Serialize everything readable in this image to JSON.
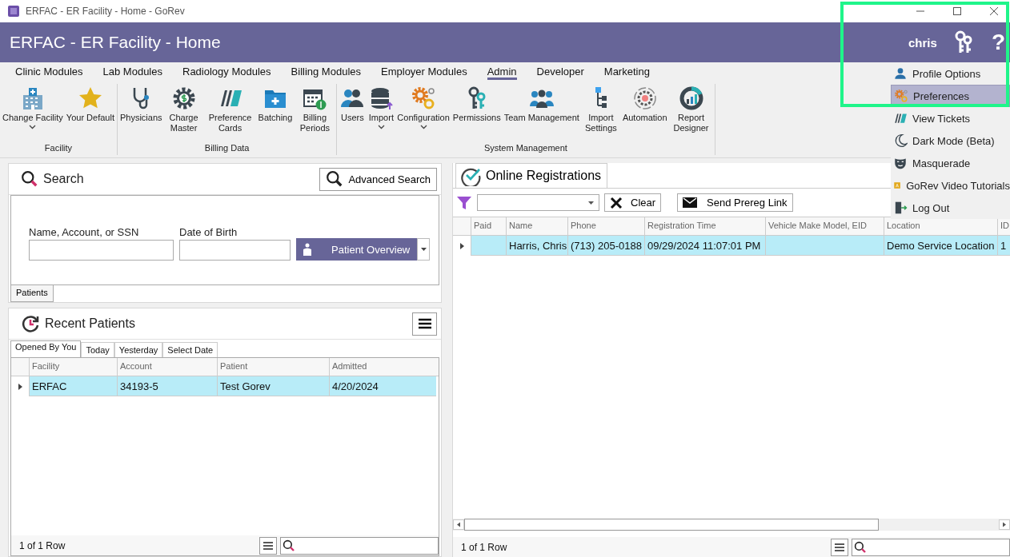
{
  "window": {
    "title": "ERFAC - ER Facility - Home - GoRev"
  },
  "header": {
    "title": "ERFAC - ER Facility - Home",
    "user": "chris",
    "help": "?"
  },
  "ribbon_tabs": [
    {
      "label": "Clinic Modules",
      "selected": false
    },
    {
      "label": "Lab Modules",
      "selected": false
    },
    {
      "label": "Radiology Modules",
      "selected": false
    },
    {
      "label": "Billing Modules",
      "selected": false
    },
    {
      "label": "Employer Modules",
      "selected": false
    },
    {
      "label": "Admin",
      "selected": true
    },
    {
      "label": "Developer",
      "selected": false
    },
    {
      "label": "Marketing",
      "selected": false
    }
  ],
  "ribbon_groups": [
    {
      "label": "Facility",
      "buttons": [
        {
          "label": "Change Facility",
          "dropdown": true
        },
        {
          "label": "Your Default",
          "dropdown": false
        }
      ]
    },
    {
      "label": "Billing Data",
      "buttons": [
        {
          "label": "Physicians",
          "dropdown": false
        },
        {
          "label": "Charge Master",
          "dropdown": false
        },
        {
          "label": "Preference Cards",
          "dropdown": false
        },
        {
          "label": "Batching",
          "dropdown": false
        },
        {
          "label": "Billing Periods",
          "dropdown": false
        }
      ]
    },
    {
      "label": "System Management",
      "buttons": [
        {
          "label": "Users",
          "dropdown": false
        },
        {
          "label": "Import",
          "dropdown": true
        },
        {
          "label": "Configuration",
          "dropdown": true
        },
        {
          "label": "Permissions",
          "dropdown": false
        },
        {
          "label": "Team Management",
          "dropdown": false
        },
        {
          "label": "Import Settings",
          "dropdown": false
        },
        {
          "label": "Automation",
          "dropdown": false
        },
        {
          "label": "Report Designer",
          "dropdown": false
        }
      ]
    }
  ],
  "search_panel": {
    "title": "Search",
    "advanced_search": "Advanced Search",
    "fields": [
      {
        "label": "Name, Account, or SSN"
      },
      {
        "label": "Date of Birth"
      }
    ],
    "patient_overview": "Patient Overview",
    "tabs": [
      {
        "label": "Patients",
        "selected": true
      }
    ]
  },
  "recent_patients": {
    "title": "Recent Patients",
    "tabs": [
      {
        "label": "Opened By You",
        "selected": true
      },
      {
        "label": "Today",
        "selected": false
      },
      {
        "label": "Yesterday",
        "selected": false
      },
      {
        "label": "Select Date",
        "selected": false
      }
    ],
    "columns": [
      "Facility",
      "Account",
      "Patient",
      "Admitted"
    ],
    "rows": [
      {
        "cells": [
          "ERFAC",
          "34193-5",
          "Test Gorev",
          "4/20/2024"
        ],
        "selected": true
      }
    ],
    "footer": "1 of 1 Row"
  },
  "online_registrations": {
    "title": "Online Registrations",
    "clear": "Clear",
    "send_link": "Send Prereg Link",
    "columns": [
      "Paid",
      "Name",
      "Phone",
      "Registration Time",
      "Vehicle Make Model, EID",
      "Location",
      "ID"
    ],
    "rows": [
      {
        "selected": true,
        "name": "Harris, Chris",
        "phone": "(713) 205-0188",
        "registration_time": "09/29/2024 11:07:01 PM",
        "location": "Demo Service Location",
        "id": "1"
      }
    ],
    "footer": "1 of 1 Row"
  },
  "user_menu": {
    "items": [
      {
        "label": "Profile Options",
        "selected": false
      },
      {
        "label": "Preferences",
        "selected": true
      },
      {
        "label": "View Tickets",
        "selected": false
      },
      {
        "label": "Dark Mode (Beta)",
        "selected": false
      },
      {
        "label": "Masquerade",
        "selected": false
      },
      {
        "label": "GoRev Video Tutorials",
        "selected": false
      },
      {
        "label": "Log Out",
        "selected": false
      }
    ]
  }
}
